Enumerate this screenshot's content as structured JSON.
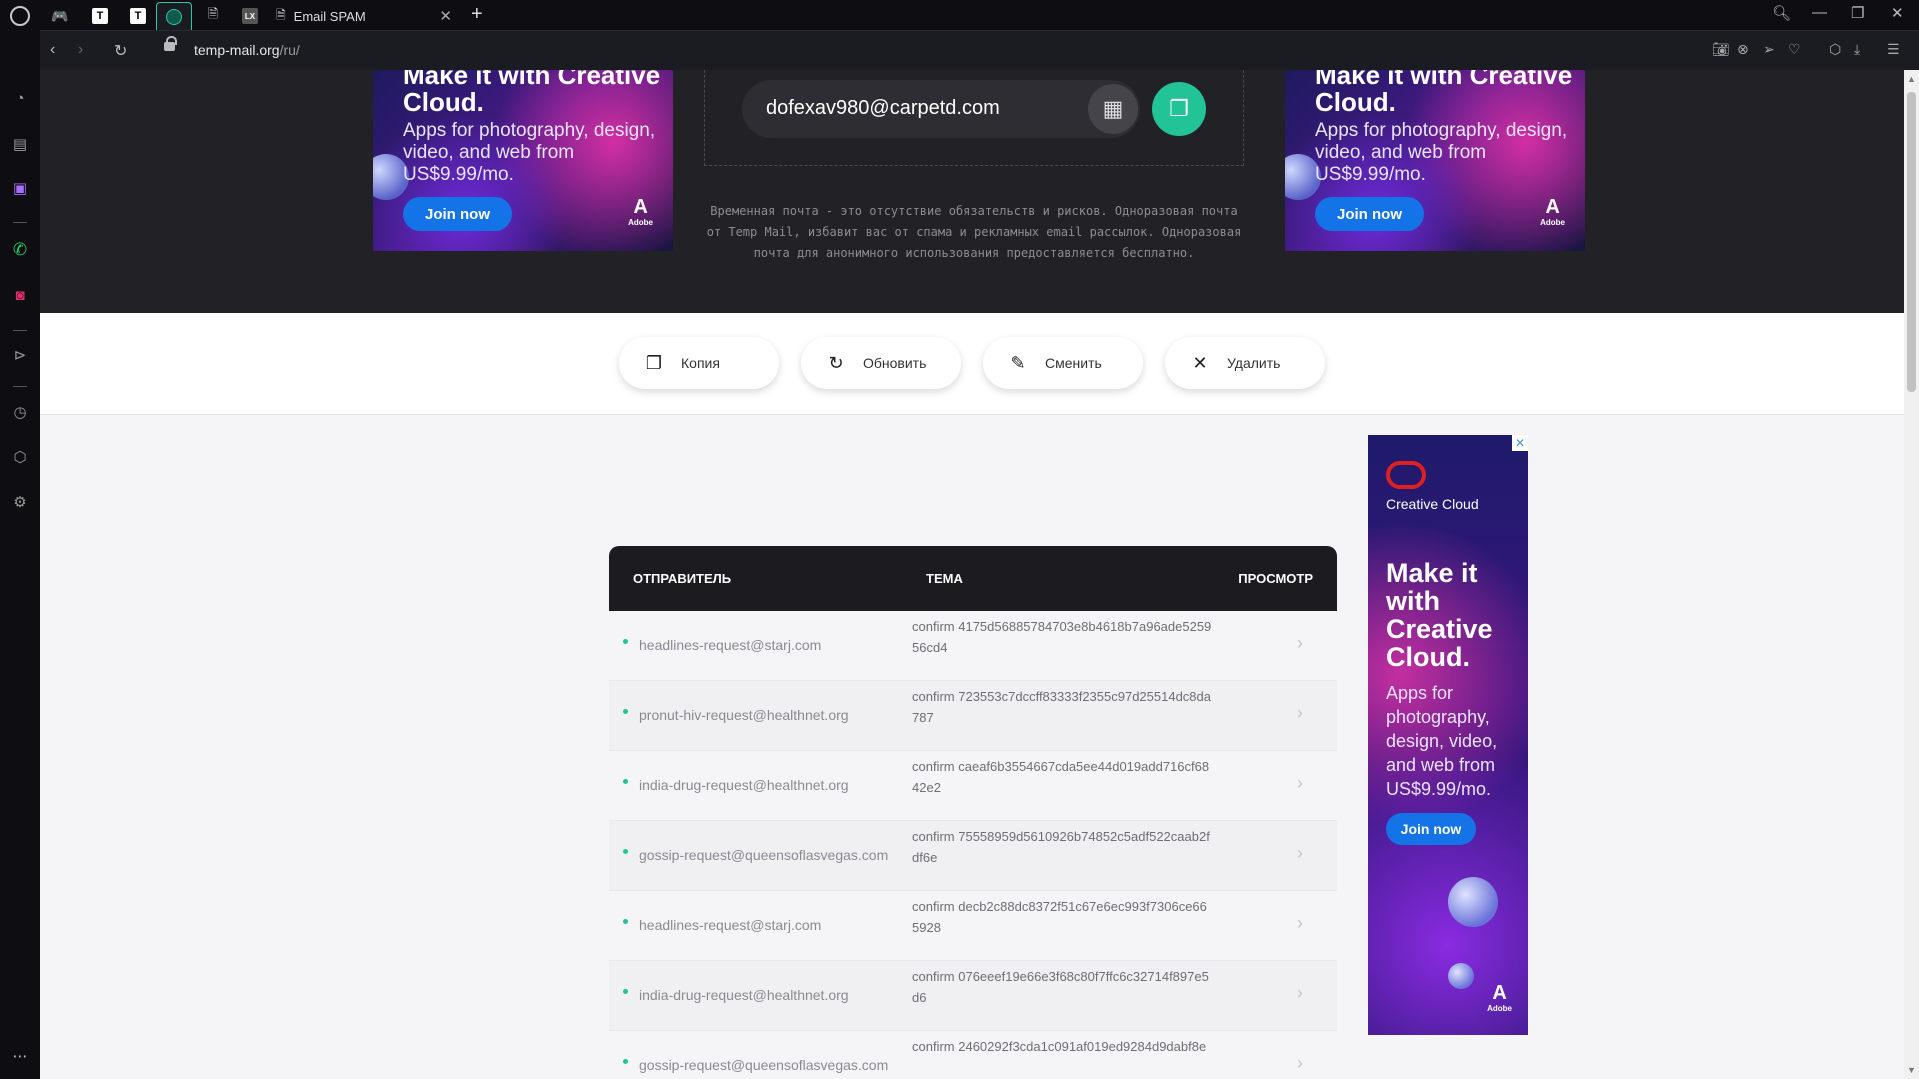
{
  "browser": {
    "tab_title": "Email SPAM",
    "tab_favicons": [
      "T",
      "T",
      "LX"
    ],
    "url_host": "temp-mail.org",
    "url_path": "/ru/"
  },
  "hero": {
    "email": "dofexav980@carpetd.com",
    "description": "Временная почта - это отсутствие обязательств и рисков. Одноразовая почта от Temp Mail, избавит вас от спама и рекламных email рассылок. Одноразовая почта для анонимного использования предоставляется бесплатно."
  },
  "ads": {
    "headline": "Make it with Creative Cloud.",
    "headline_short": "Make it with Creative Cloud.",
    "sub": "Apps for photography, design, video, and web from US$9.99/mo.",
    "join": "Join now",
    "brand": "Adobe",
    "brand_logo": "A",
    "cc_name": "Creative Cloud"
  },
  "actions": {
    "copy": "Копия",
    "refresh": "Обновить",
    "change": "Сменить",
    "delete": "Удалить"
  },
  "inbox": {
    "col_sender": "ОТПРАВИТЕЛЬ",
    "col_subject": "ТЕМА",
    "col_view": "ПРОСМОТР",
    "rows": [
      {
        "sender": "headlines-request@starj.com",
        "subject": "confirm 4175d56885784703e8b4618b7a96ade525956cd4"
      },
      {
        "sender": "pronut-hiv-request@healthnet.org",
        "subject": "confirm 723553c7dccff83333f2355c97d25514dc8da787"
      },
      {
        "sender": "india-drug-request@healthnet.org",
        "subject": "confirm caeaf6b3554667cda5ee44d019add716cf6842e2"
      },
      {
        "sender": "gossip-request@queensoflasvegas.com",
        "subject": "confirm 75558959d5610926b74852c5adf522caab2fdf6e"
      },
      {
        "sender": "headlines-request@starj.com",
        "subject": "confirm decb2c88dc8372f51c67e6ec993f7306ce665928"
      },
      {
        "sender": "india-drug-request@healthnet.org",
        "subject": "confirm 076eeef19e66e3f68c80f7ffc6c32714f897e5d6"
      },
      {
        "sender": "gossip-request@queensoflasvegas.com",
        "subject": "confirm 2460292f3cda1c091af019ed9284d9dabf8e"
      }
    ]
  },
  "colors": {
    "accent": "#22c497",
    "hero_bg": "#222126",
    "ad_button": "#1473e6"
  }
}
